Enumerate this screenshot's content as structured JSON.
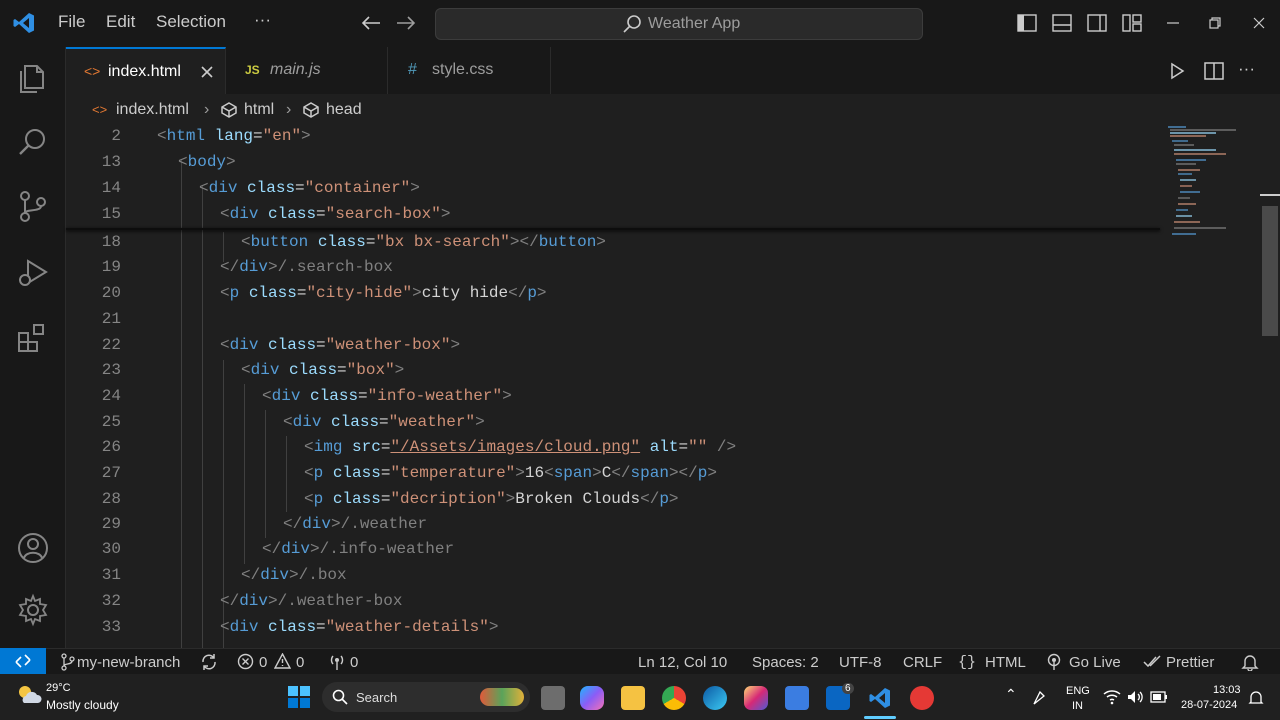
{
  "menu": {
    "file": "File",
    "edit": "Edit",
    "selection": "Selection",
    "more": "···"
  },
  "command_center": {
    "label": "Weather App"
  },
  "tabs": [
    {
      "label": "index.html",
      "icon": "html-icon",
      "active": true
    },
    {
      "label": "main.js",
      "icon": "js-icon",
      "active": false
    },
    {
      "label": "style.css",
      "icon": "css-icon",
      "active": false
    }
  ],
  "tab_icons": {
    "html": "<>",
    "js": "JS",
    "css": "#"
  },
  "breadcrumb": {
    "file": "index.html",
    "node1": "html",
    "node2": "head"
  },
  "line_numbers": [
    "2",
    "13",
    "14",
    "15",
    "18",
    "19",
    "20",
    "21",
    "22",
    "23",
    "24",
    "25",
    "26",
    "27",
    "28",
    "29",
    "30",
    "31",
    "32",
    "33"
  ],
  "code": {
    "l2": {
      "open": "<",
      "tag": "html",
      "attr": "lang",
      "eq": "=",
      "val": "\"en\"",
      "close": ">"
    },
    "l13": {
      "open": "<",
      "tag": "body",
      "close": ">"
    },
    "l14": {
      "open": "<",
      "tag": "div",
      "attr": "class",
      "eq": "=",
      "val": "\"container\"",
      "close": ">"
    },
    "l15": {
      "open": "<",
      "tag": "div",
      "attr": "class",
      "eq": "=",
      "val": "\"search-box\"",
      "close": ">"
    },
    "l18": {
      "open": "<",
      "tag": "button",
      "attr": "class",
      "eq": "=",
      "val": "\"bx bx-search\"",
      "close": "></",
      "tag2": "button",
      "close2": ">"
    },
    "l19": {
      "open": "</",
      "tag": "div",
      "close": ">",
      "text": "/.search-box"
    },
    "l20": {
      "open": "<",
      "tag": "p",
      "attr": "class",
      "eq": "=",
      "val": "\"city-hide\"",
      "close": ">",
      "text": "city hide",
      "open2": "</",
      "tag2": "p",
      "close2": ">"
    },
    "l22": {
      "open": "<",
      "tag": "div",
      "attr": "class",
      "eq": "=",
      "val": "\"weather-box\"",
      "close": ">"
    },
    "l23": {
      "open": "<",
      "tag": "div",
      "attr": "class",
      "eq": "=",
      "val": "\"box\"",
      "close": ">"
    },
    "l24": {
      "open": "<",
      "tag": "div",
      "attr": "class",
      "eq": "=",
      "val": "\"info-weather\"",
      "close": ">"
    },
    "l25": {
      "open": "<",
      "tag": "div",
      "attr": "class",
      "eq": "=",
      "val": "\"weather\"",
      "close": ">"
    },
    "l26": {
      "open": "<",
      "tag": "img",
      "attr": "src",
      "eq": "=",
      "val": "\"/Assets/images/cloud.png\"",
      "attr2": "alt",
      "eq2": "=",
      "val2": "\"\"",
      "close": " />"
    },
    "l27": {
      "open": "<",
      "tag": "p",
      "attr": "class",
      "eq": "=",
      "val": "\"temperature\"",
      "close": ">",
      "text": "16",
      "open2": "<",
      "tag2": "span",
      "close2": ">",
      "text2": "C",
      "open3": "</",
      "tag3": "span",
      "close3": "></",
      "tag4": "p",
      "close4": ">"
    },
    "l28": {
      "open": "<",
      "tag": "p",
      "attr": "class",
      "eq": "=",
      "val": "\"decription\"",
      "close": ">",
      "text": "Broken Clouds",
      "open2": "</",
      "tag2": "p",
      "close2": ">"
    },
    "l29": {
      "open": "</",
      "tag": "div",
      "close": ">",
      "text": "/.weather"
    },
    "l30": {
      "open": "</",
      "tag": "div",
      "close": ">",
      "text": "/.info-weather"
    },
    "l31": {
      "open": "</",
      "tag": "div",
      "close": ">",
      "text": "/.box"
    },
    "l32": {
      "open": "</",
      "tag": "div",
      "close": ">",
      "text": "/.weather-box"
    },
    "l33": {
      "open": "<",
      "tag": "div",
      "attr": "class",
      "eq": "=",
      "val": "\"weather-details\"",
      "close": ">"
    }
  },
  "status": {
    "branch": "my-new-branch",
    "errors": "0",
    "warnings": "0",
    "ports": "0",
    "position": "Ln 12, Col 10",
    "spaces": "Spaces: 2",
    "encoding": "UTF-8",
    "eol": "CRLF",
    "language": "HTML",
    "golive": "Go Live",
    "prettier": "Prettier"
  },
  "taskbar": {
    "temp": "29°C",
    "weather": "Mostly cloudy",
    "search": "Search",
    "lang1": "ENG",
    "lang2": "IN",
    "time": "13:03",
    "date": "28-07-2024",
    "badge": "6"
  },
  "colors": {
    "accent": "#0078d4",
    "tag": "#569cd6",
    "attr": "#9cdcfe",
    "string": "#ce9178"
  }
}
